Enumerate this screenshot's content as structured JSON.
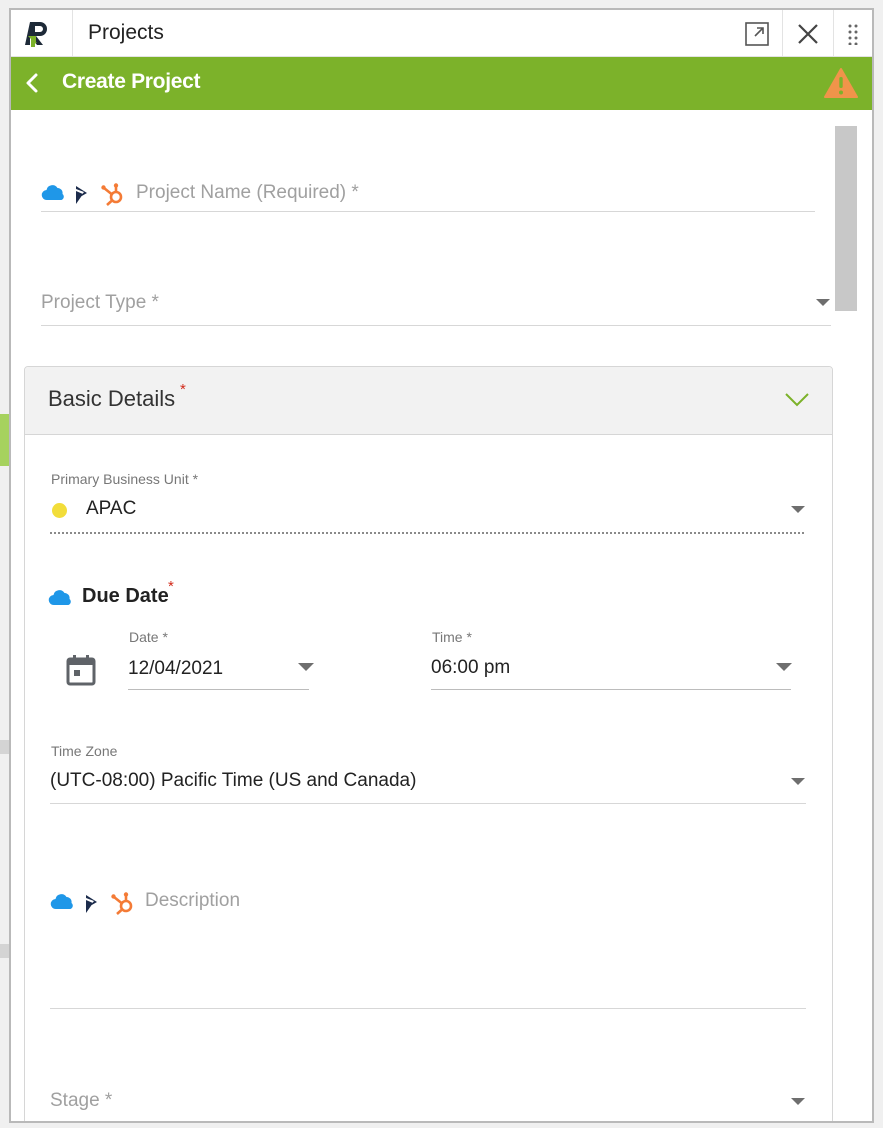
{
  "window": {
    "app_title": "Projects",
    "icons": {
      "logo": "r-logo-icon",
      "expand": "expand-icon",
      "close": "close-icon",
      "drag": "drag-handle-icon"
    }
  },
  "header": {
    "title": "Create Project",
    "back_icon": "chevron-left-icon",
    "warning_icon": "warning-icon",
    "accent_color": "#7cb22a"
  },
  "form": {
    "project_name": {
      "placeholder": "Project Name (Required) *",
      "value": ""
    },
    "project_type": {
      "placeholder": "Project Type *",
      "value": ""
    },
    "basic_details": {
      "title": "Basic Details",
      "required_mark": "*",
      "primary_business_unit": {
        "label": "Primary Business Unit *",
        "value": "APAC",
        "dot_color": "#f2dd3a"
      },
      "due_date": {
        "title": "Due Date",
        "required_mark": "*",
        "date": {
          "label": "Date *",
          "value": "12/04/2021"
        },
        "time": {
          "label": "Time *",
          "value": "06:00 pm"
        }
      },
      "time_zone": {
        "label": "Time Zone",
        "value": "(UTC-08:00) Pacific Time (US and Canada)"
      },
      "description": {
        "placeholder": "Description",
        "value": ""
      },
      "stage": {
        "placeholder": "Stage *",
        "value": ""
      }
    }
  },
  "integration_icons": [
    "salesforce-cloud-icon",
    "dynamics-icon",
    "hubspot-icon"
  ]
}
